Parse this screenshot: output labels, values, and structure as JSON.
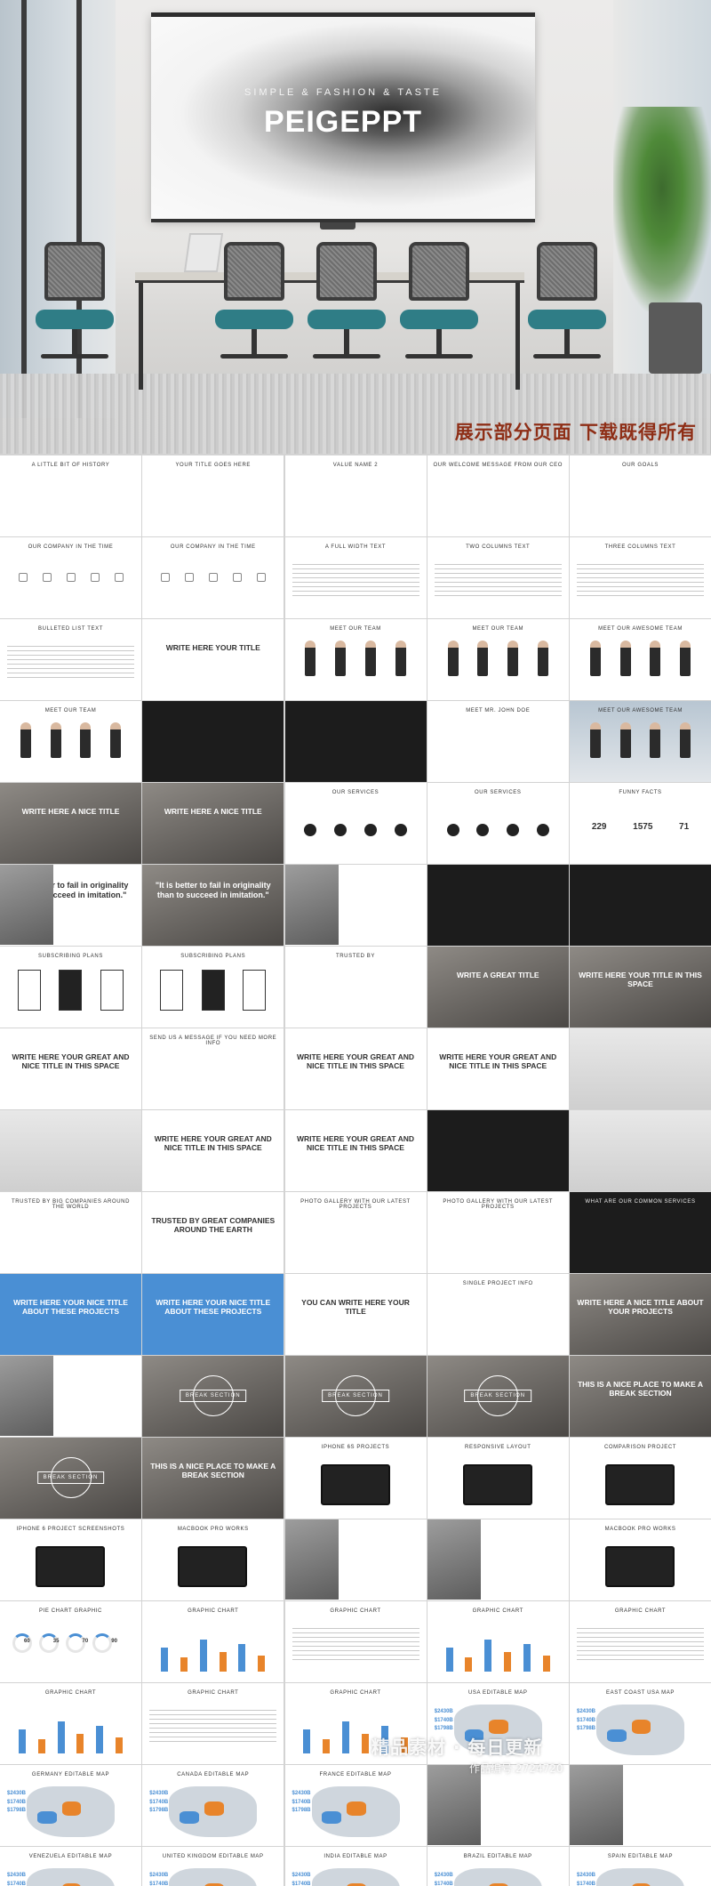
{
  "hero": {
    "subtitle": "SIMPLE & FASHION & TASTE",
    "brand": "PEIGEPPT",
    "tagline_cn": "展示部分页面  下载既得所有"
  },
  "slides": [
    {
      "title": "A LITTLE BIT OF HISTORY",
      "style": "plain"
    },
    {
      "title": "YOUR TITLE GOES HERE",
      "style": "plain"
    },
    {
      "title": "VALUE NAME 2",
      "style": "plain"
    },
    {
      "title": "OUR WELCOME MESSAGE FROM OUR CEO",
      "style": "plain"
    },
    {
      "title": "OUR GOALS",
      "style": "plain"
    },
    {
      "title": "OUR COMPANY IN THE TIME",
      "style": "plain"
    },
    {
      "title": "OUR COMPANY IN THE TIME",
      "style": "plain"
    },
    {
      "title": "A FULL WIDTH TEXT",
      "style": "plain"
    },
    {
      "title": "TWO COLUMNS TEXT",
      "style": "plain"
    },
    {
      "title": "THREE COLUMNS TEXT",
      "style": "plain"
    },
    {
      "title": "BULLETED LIST TEXT",
      "style": "plain"
    },
    {
      "title": "WRITE HERE YOUR TITLE",
      "style": "plain"
    },
    {
      "title": "MEET OUR TEAM",
      "style": "plain"
    },
    {
      "title": "MEET OUR TEAM",
      "style": "plain"
    },
    {
      "title": "MEET OUR AWESOME TEAM",
      "style": "plain"
    },
    {
      "title": "MEET OUR TEAM",
      "style": "plain"
    },
    {
      "title": "",
      "style": "dark"
    },
    {
      "title": "",
      "style": "dark"
    },
    {
      "title": "MEET MR. JOHN DOE",
      "style": "plain"
    },
    {
      "title": "MEET OUR AWESOME TEAM",
      "style": "sky"
    },
    {
      "title": "WRITE HERE A NICE TITLE",
      "style": "photo"
    },
    {
      "title": "WRITE HERE A NICE TITLE",
      "style": "photo"
    },
    {
      "title": "OUR SERVICES",
      "style": "plain"
    },
    {
      "title": "OUR SERVICES",
      "style": "plain"
    },
    {
      "title": "FUNNY FACTS",
      "style": "plain"
    },
    {
      "title": "",
      "quote": "\"It is better to fail in originality than to succeed in imitation.\"",
      "style": "plain"
    },
    {
      "title": "",
      "quote": "\"It is better to fail in originality than to succeed in imitation.\"",
      "style": "photo"
    },
    {
      "title": "",
      "style": "plain"
    },
    {
      "title": "",
      "style": "dark"
    },
    {
      "title": "",
      "style": "dark"
    },
    {
      "title": "SUBSCRIBING PLANS",
      "style": "plain"
    },
    {
      "title": "SUBSCRIBING PLANS",
      "style": "plain"
    },
    {
      "title": "TRUSTED BY",
      "style": "plain"
    },
    {
      "title": "WRITE A GREAT TITLE",
      "style": "photo"
    },
    {
      "title": "WRITE HERE YOUR TITLE IN THIS SPACE",
      "style": "photo"
    },
    {
      "title": "WRITE HERE YOUR GREAT AND NICE TITLE IN THIS SPACE",
      "style": "plain"
    },
    {
      "title": "SEND US A MESSAGE IF YOU NEED MORE INFO",
      "style": "plain"
    },
    {
      "title": "WRITE HERE YOUR GREAT AND NICE TITLE IN THIS SPACE",
      "style": "plain"
    },
    {
      "title": "WRITE HERE YOUR GREAT AND NICE TITLE IN THIS SPACE",
      "style": "plain"
    },
    {
      "title": "",
      "style": "gray"
    },
    {
      "title": "",
      "style": "gray"
    },
    {
      "title": "WRITE HERE YOUR GREAT AND NICE TITLE IN THIS SPACE",
      "style": "plain"
    },
    {
      "title": "WRITE HERE YOUR GREAT AND NICE TITLE IN THIS SPACE",
      "style": "plain"
    },
    {
      "title": "",
      "style": "dark"
    },
    {
      "title": "",
      "style": "gray"
    },
    {
      "title": "TRUSTED BY BIG COMPANIES AROUND THE WORLD",
      "style": "plain"
    },
    {
      "title": "TRUSTED BY GREAT COMPANIES AROUND THE EARTH",
      "style": "plain"
    },
    {
      "title": "PHOTO GALLERY WITH OUR LATEST PROJECTS",
      "style": "plain"
    },
    {
      "title": "PHOTO GALLERY WITH OUR LATEST PROJECTS",
      "style": "plain"
    },
    {
      "title": "WHAT ARE OUR COMMON SERVICES",
      "style": "dark"
    },
    {
      "title": "WRITE HERE YOUR NICE TITLE ABOUT THESE PROJECTS",
      "style": "blue"
    },
    {
      "title": "WRITE HERE YOUR NICE TITLE ABOUT THESE PROJECTS",
      "style": "blue"
    },
    {
      "title": "YOU CAN WRITE HERE YOUR TITLE",
      "style": "plain"
    },
    {
      "title": "SINGLE PROJECT INFO",
      "style": "plain"
    },
    {
      "title": "WRITE HERE A NICE TITLE ABOUT YOUR PROJECTS",
      "style": "photo"
    },
    {
      "title": "",
      "style": "plain"
    },
    {
      "title": "BREAK SECTION",
      "style": "photo"
    },
    {
      "title": "BREAK SECTION",
      "style": "photo"
    },
    {
      "title": "BREAK SECTION",
      "style": "photo"
    },
    {
      "title": "THIS IS A NICE PLACE TO MAKE A BREAK SECTION",
      "style": "photo"
    },
    {
      "title": "BREAK SECTION",
      "style": "photo"
    },
    {
      "title": "THIS IS A NICE PLACE TO MAKE A BREAK SECTION",
      "style": "photo"
    },
    {
      "title": "IPHONE 6S PROJECTS",
      "style": "plain"
    },
    {
      "title": "RESPONSIVE LAYOUT",
      "style": "plain"
    },
    {
      "title": "COMPARISON PROJECT",
      "style": "plain"
    },
    {
      "title": "IPHONE 6 PROJECT SCREENSHOTS",
      "style": "plain"
    },
    {
      "title": "MACBOOK PRO WORKS",
      "style": "plain"
    },
    {
      "title": "",
      "style": "plain"
    },
    {
      "title": "",
      "style": "plain"
    },
    {
      "title": "MACBOOK PRO WORKS",
      "style": "plain"
    },
    {
      "title": "PIE CHART GRAPHIC",
      "style": "plain"
    },
    {
      "title": "GRAPHIC CHART",
      "style": "plain"
    },
    {
      "title": "GRAPHIC CHART",
      "style": "plain"
    },
    {
      "title": "GRAPHIC CHART",
      "style": "plain"
    },
    {
      "title": "GRAPHIC CHART",
      "style": "plain"
    },
    {
      "title": "GRAPHIC CHART",
      "style": "plain"
    },
    {
      "title": "GRAPHIC CHART",
      "style": "plain"
    },
    {
      "title": "GRAPHIC CHART",
      "style": "plain"
    },
    {
      "title": "USA EDITABLE MAP",
      "style": "plain"
    },
    {
      "title": "EAST COAST USA MAP",
      "style": "plain"
    },
    {
      "title": "GERMANY EDITABLE MAP",
      "style": "plain"
    },
    {
      "title": "CANADA EDITABLE MAP",
      "style": "plain"
    },
    {
      "title": "FRANCE EDITABLE MAP",
      "style": "plain"
    },
    {
      "title": "",
      "style": "plain"
    },
    {
      "title": "",
      "style": "plain"
    },
    {
      "title": "VENEZUELA EDITABLE MAP",
      "style": "plain"
    },
    {
      "title": "UNITED KINGDOM EDITABLE MAP",
      "style": "plain"
    },
    {
      "title": "INDIA EDITABLE MAP",
      "style": "plain"
    },
    {
      "title": "BRAZIL EDITABLE MAP",
      "style": "plain"
    },
    {
      "title": "SPAIN EDITABLE MAP",
      "style": "plain"
    }
  ],
  "pie_values": [
    "60",
    "35",
    "70",
    "90"
  ],
  "funny_facts": [
    "229",
    "1575",
    "71"
  ],
  "map_stats": [
    "$2430B",
    "$1740B",
    "$1798B"
  ],
  "watermark": {
    "main": "精品素材 · 每日更新",
    "sub": "作品编号:2724720"
  },
  "colors": {
    "accent_blue": "#4a8fd4",
    "accent_orange": "#e8842a",
    "tagline_red": "#8e2e16",
    "chair_teal": "#2f7d86"
  }
}
